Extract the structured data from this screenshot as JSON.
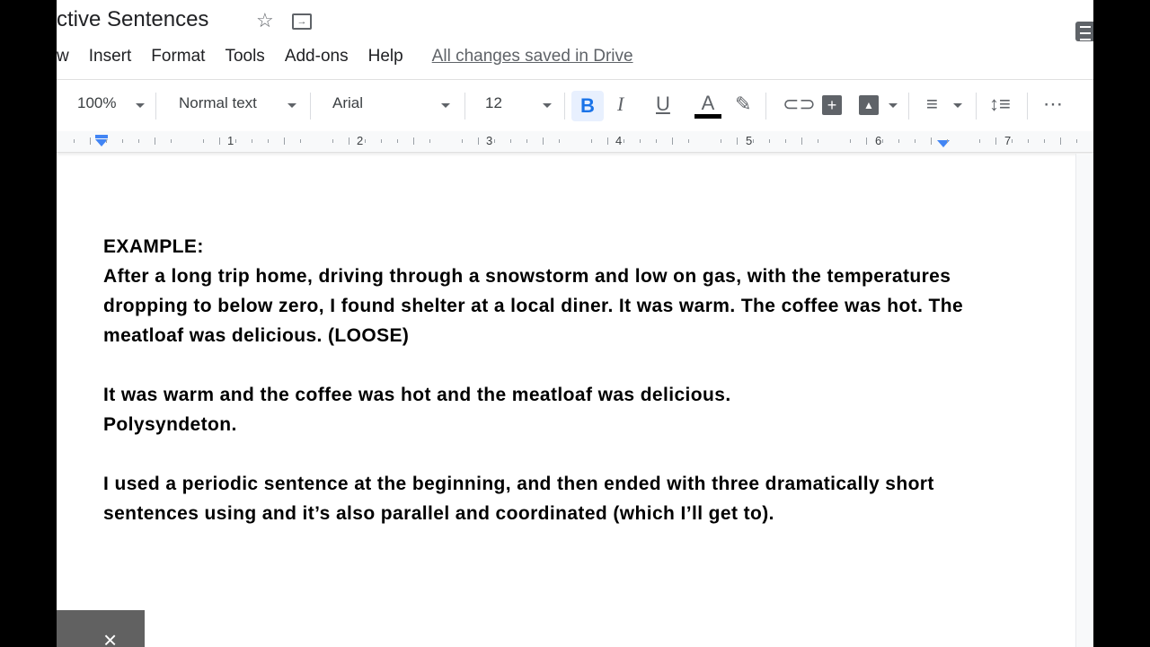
{
  "doc_title": "ctive Sentences",
  "menu": [
    "w",
    "Insert",
    "Format",
    "Tools",
    "Add-ons",
    "Help"
  ],
  "save_status": "All changes saved in Drive",
  "toolbar": {
    "zoom": "100%",
    "style": "Normal text",
    "font": "Arial",
    "size": "12",
    "bold": "B",
    "italic": "I",
    "underline": "U",
    "text_color": "A",
    "more": "⋯"
  },
  "ruler": [
    "1",
    "2",
    "3",
    "4",
    "5",
    "6",
    "7"
  ],
  "document": {
    "paragraphs": [
      "EXAMPLE:\nAfter a long trip home, driving through a snowstorm and low on gas, with the temperatures dropping to below zero, I found shelter at a local diner. It was warm. The coffee was hot. The meatloaf was delicious. (LOOSE)",
      "",
      "It was warm and the coffee was hot and the meatloaf was delicious.\nPolysyndeton.",
      "",
      "I used a periodic sentence at the beginning, and then ended with three dramatically short sentences using and it’s also parallel and coordinated (which I’ll get to)."
    ]
  },
  "snackbar_close": "×",
  "colors": {
    "accent": "#1a73e8",
    "bold_bg": "#e8f0fe"
  }
}
